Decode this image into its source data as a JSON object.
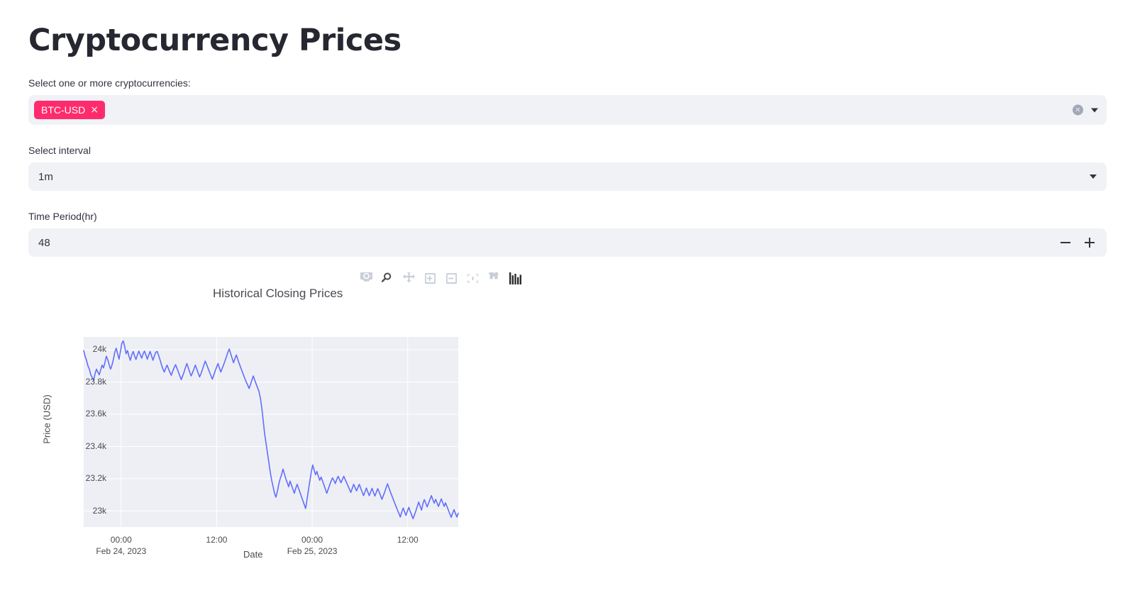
{
  "page": {
    "title": "Cryptocurrency Prices"
  },
  "crypto_select": {
    "label": "Select one or more cryptocurrencies:",
    "selected": [
      {
        "value": "BTC-USD",
        "remove_glyph": "×"
      }
    ],
    "clear_glyph": "×",
    "tag_color": "#FF2B6D"
  },
  "interval_select": {
    "label": "Select interval",
    "value": "1m"
  },
  "time_period": {
    "label": "Time Period(hr)",
    "value": "48",
    "decrement_label": "−",
    "increment_label": "+"
  },
  "modebar": {
    "buttons": [
      {
        "name": "download-plot-icon",
        "title": "Download plot as a png"
      },
      {
        "name": "zoom-icon",
        "title": "Zoom"
      },
      {
        "name": "pan-icon",
        "title": "Pan"
      },
      {
        "name": "zoom-in-icon",
        "title": "Zoom in"
      },
      {
        "name": "zoom-out-icon",
        "title": "Zoom out"
      },
      {
        "name": "autoscale-icon",
        "title": "Autoscale"
      },
      {
        "name": "reset-axes-icon",
        "title": "Reset axes"
      },
      {
        "name": "toggle-spike-lines-icon",
        "title": "Toggle Spike Lines"
      }
    ]
  },
  "chart_data": {
    "type": "line",
    "title": "Historical Closing Prices",
    "xlabel": "Date",
    "ylabel": "Price (USD)",
    "grid": true,
    "legend": "none",
    "line_color": "#636EFA",
    "plot_bgcolor": "#EDEFF5",
    "paper_bgcolor": "#FFFFFF",
    "ylim": [
      22900,
      24080
    ],
    "ytick_values": [
      23000,
      23200,
      23400,
      23600,
      23800,
      24000
    ],
    "ytick_labels": [
      "23k",
      "23.2k",
      "23.4k",
      "23.6k",
      "23.8k",
      "24k"
    ],
    "xtick_labels": [
      {
        "time": "00:00",
        "date": "Feb 24, 2023"
      },
      {
        "time": "12:00",
        "date": ""
      },
      {
        "time": "00:00",
        "date": "Feb 25, 2023"
      },
      {
        "time": "12:00",
        "date": ""
      }
    ],
    "xlim": [
      "2023-02-23 20:30",
      "2023-02-25 20:30"
    ],
    "series": [
      {
        "name": "BTC-USD",
        "values": [
          23995,
          23960,
          23935,
          23900,
          23880,
          23845,
          23828,
          23812,
          23850,
          23880,
          23862,
          23845,
          23875,
          23905,
          23888,
          23920,
          23960,
          23940,
          23908,
          23880,
          23905,
          23940,
          23985,
          24010,
          23975,
          23942,
          23990,
          24042,
          24055,
          24020,
          23975,
          23996,
          23960,
          23935,
          23968,
          23990,
          23962,
          23940,
          23968,
          23992,
          23970,
          23948,
          23975,
          23992,
          23968,
          23942,
          23968,
          23990,
          23962,
          23935,
          23962,
          23985,
          23990,
          23965,
          23938,
          23908,
          23882,
          23862,
          23885,
          23905,
          23882,
          23860,
          23842,
          23868,
          23890,
          23908,
          23885,
          23862,
          23838,
          23815,
          23838,
          23862,
          23890,
          23915,
          23888,
          23862,
          23838,
          23858,
          23882,
          23905,
          23880,
          23855,
          23832,
          23852,
          23878,
          23905,
          23930,
          23908,
          23885,
          23862,
          23840,
          23818,
          23842,
          23868,
          23892,
          23915,
          23888,
          23862,
          23885,
          23908,
          23932,
          23958,
          23985,
          24005,
          23975,
          23948,
          23920,
          23945,
          23968,
          23942,
          23915,
          23892,
          23868,
          23845,
          23822,
          23800,
          23782,
          23760,
          23785,
          23812,
          23838,
          23812,
          23788,
          23765,
          23742,
          23700,
          23640,
          23560,
          23480,
          23420,
          23360,
          23300,
          23240,
          23190,
          23150,
          23110,
          23085,
          23120,
          23165,
          23200,
          23225,
          23260,
          23230,
          23200,
          23175,
          23150,
          23185,
          23160,
          23135,
          23110,
          23140,
          23165,
          23140,
          23115,
          23090,
          23065,
          23040,
          23015,
          23070,
          23130,
          23185,
          23240,
          23285,
          23255,
          23225,
          23245,
          23215,
          23190,
          23210,
          23185,
          23160,
          23135,
          23110,
          23135,
          23160,
          23185,
          23205,
          23190,
          23170,
          23195,
          23215,
          23195,
          23175,
          23195,
          23215,
          23195,
          23175,
          23155,
          23135,
          23115,
          23140,
          23165,
          23145,
          23125,
          23145,
          23165,
          23140,
          23118,
          23095,
          23118,
          23142,
          23118,
          23095,
          23118,
          23140,
          23115,
          23092,
          23115,
          23138,
          23118,
          23095,
          23072,
          23095,
          23118,
          23145,
          23168,
          23142,
          23118,
          23095,
          23072,
          23050,
          23028,
          23005,
          22985,
          22962,
          22992,
          23018,
          22995,
          22972,
          22998,
          23022,
          22998,
          22975,
          22952,
          22975,
          23000,
          23028,
          23055,
          23030,
          23005,
          23045,
          23070,
          23048,
          23025,
          23048,
          23072,
          23095,
          23070,
          23048,
          23072,
          23050,
          23028,
          23052,
          23075,
          23052,
          23028,
          23050,
          23028,
          23005,
          22982,
          22960,
          22985,
          23008,
          22985,
          22962,
          22985
        ]
      }
    ]
  }
}
